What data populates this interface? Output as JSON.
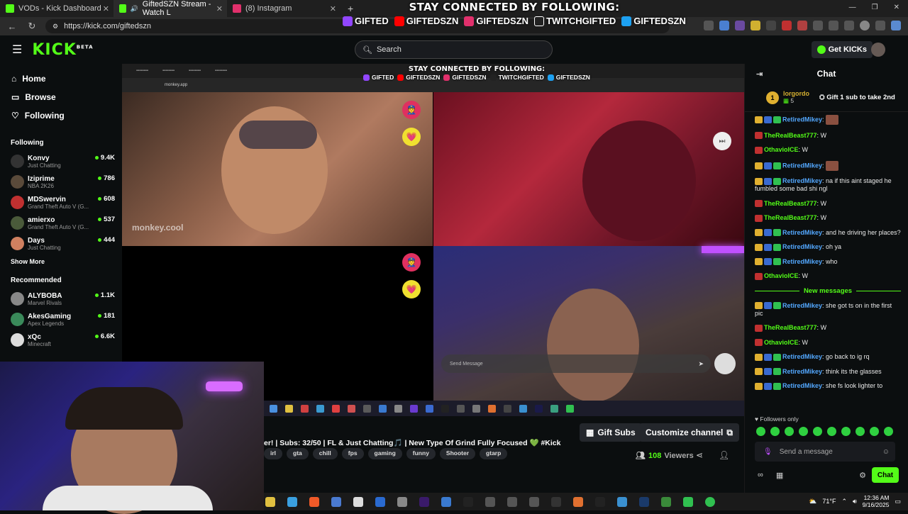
{
  "browser": {
    "tabs": [
      {
        "label": "VODs - Kick Dashboard",
        "color": "#53fc18"
      },
      {
        "label": "GiftedSZN Stream - Watch L",
        "color": "#53fc18"
      },
      {
        "label": "(8) Instagram",
        "color": "#e1306c"
      }
    ],
    "url": "https://kick.com/giftedszn"
  },
  "overlay": {
    "title": "STAY CONNECTED BY FOLLOWING:",
    "socials": [
      {
        "label": "GIFTED",
        "icon": "twitch-icon",
        "color": "#9146ff"
      },
      {
        "label": "GIFTEDSZN",
        "icon": "youtube-icon",
        "color": "#ff0000"
      },
      {
        "label": "GIFTEDSZN",
        "icon": "instagram-icon",
        "color": "#e1306c"
      },
      {
        "label": "TWITCHGIFTED",
        "icon": "tiktok-icon",
        "color": "#222222"
      },
      {
        "label": "GIFTEDSZN",
        "icon": "twitter-icon",
        "color": "#1da1f2"
      }
    ]
  },
  "header": {
    "logo": "KICK",
    "logo_beta": "BETA",
    "search_placeholder": "Search",
    "get_kicks": "Get KICKs"
  },
  "sidebar": {
    "nav": [
      {
        "label": "Home",
        "icon": "home-icon"
      },
      {
        "label": "Browse",
        "icon": "browse-icon"
      },
      {
        "label": "Following",
        "icon": "heart-icon"
      }
    ],
    "following_title": "Following",
    "following": [
      {
        "name": "Konvy",
        "category": "Just Chatting",
        "viewers": "9.4K",
        "color": "#333"
      },
      {
        "name": "Iziprime",
        "category": "NBA 2K26",
        "viewers": "786",
        "color": "#5a4a3a"
      },
      {
        "name": "MDSwervin",
        "category": "Grand Theft Auto V (G...",
        "viewers": "608",
        "color": "#c03030"
      },
      {
        "name": "amierxo",
        "category": "Grand Theft Auto V (G...",
        "viewers": "537",
        "color": "#4a5a3a"
      },
      {
        "name": "Days",
        "category": "Just Chatting",
        "viewers": "444",
        "color": "#d08060"
      }
    ],
    "show_more": "Show More",
    "recommended_title": "Recommended",
    "recommended": [
      {
        "name": "ALYBOBA",
        "category": "Marvel Rivals",
        "viewers": "1.1K",
        "color": "#888"
      },
      {
        "name": "AkesGaming",
        "category": "Apex Legends",
        "viewers": "181",
        "color": "#3a8a5a"
      },
      {
        "name": "xQc",
        "category": "Minecraft",
        "viewers": "6.6K",
        "color": "#ddd"
      }
    ]
  },
  "stream": {
    "inner_url": "monkey.app",
    "watermark": "monkey.cool",
    "send_placeholder": "Send Message"
  },
  "info": {
    "gift_subs": "Gift Subs",
    "customize": "Customize channel",
    "title": "er! | Subs: 32/50 | FL & Just Chatting🎵 | New Type Of Grind Fully Focused 💚 #Kick",
    "tags": [
      "irl",
      "gta",
      "chill",
      "fps",
      "gaming",
      "funny",
      "Shooter",
      "gtarp"
    ],
    "viewers_count": "108",
    "viewers_label": "Viewers"
  },
  "chat": {
    "title": "Chat",
    "pinned_user": "lorgordo",
    "pinned_count": "5",
    "pinned_rank": "1",
    "gift_text": "Gift 1 sub to take 2nd",
    "messages": [
      {
        "user": "RetiredMikey",
        "text": "",
        "color": "#53a8ff",
        "emote": true
      },
      {
        "user": "TheRealBeast777",
        "text": "W",
        "color": "#53fc18"
      },
      {
        "user": "OthavioICE",
        "text": "W",
        "color": "#53fc18"
      },
      {
        "user": "RetiredMikey",
        "text": "",
        "color": "#53a8ff",
        "emote": true
      },
      {
        "user": "RetiredMikey",
        "text": "na if this aint staged he fumbled some bad shi ngl",
        "color": "#53a8ff"
      },
      {
        "user": "TheRealBeast777",
        "text": "W",
        "color": "#53fc18"
      },
      {
        "user": "TheRealBeast777",
        "text": "W",
        "color": "#53fc18"
      },
      {
        "user": "RetiredMikey",
        "text": "and he driving her places?",
        "color": "#53a8ff"
      },
      {
        "user": "RetiredMikey",
        "text": "oh ya",
        "color": "#53a8ff"
      },
      {
        "user": "RetiredMikey",
        "text": "who",
        "color": "#53a8ff"
      },
      {
        "user": "OthavioICE",
        "text": "W",
        "color": "#53fc18"
      }
    ],
    "new_messages_label": "New messages",
    "new_messages": [
      {
        "user": "RetiredMikey",
        "text": "she got ts on in the first pic",
        "color": "#53a8ff"
      },
      {
        "user": "TheRealBeast777",
        "text": "W",
        "color": "#53fc18"
      },
      {
        "user": "OthavioICE",
        "text": "W",
        "color": "#53fc18"
      },
      {
        "user": "RetiredMikey",
        "text": "go back to ig rq",
        "color": "#53a8ff"
      },
      {
        "user": "RetiredMikey",
        "text": "think its the glasses",
        "color": "#53a8ff"
      },
      {
        "user": "RetiredMikey",
        "text": "she fs look lighter to",
        "color": "#53a8ff"
      }
    ],
    "followers_only": "Followers only",
    "input_placeholder": "Send a message",
    "send_label": "Chat"
  },
  "taskbar": {
    "weather": "71°F",
    "time": "12:36 AM",
    "date": "9/16/2025"
  }
}
